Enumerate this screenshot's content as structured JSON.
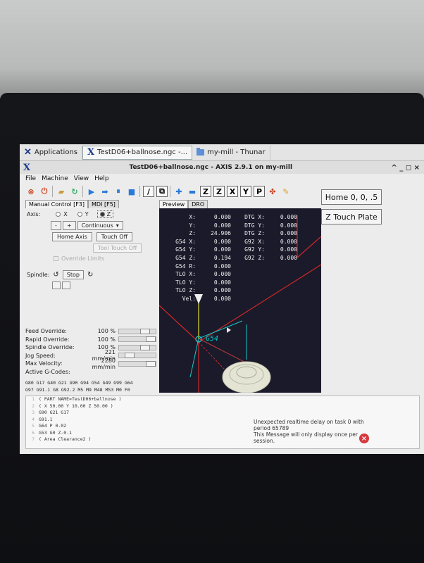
{
  "taskbar": {
    "apps_label": "Applications",
    "task1": "TestD06+ballnose.ngc -...",
    "task2": "my-mill - Thunar"
  },
  "window": {
    "title": "TestD06+ballnose.ngc - AXIS 2.9.1 on my-mill",
    "controls": "^  _  ◻  ×"
  },
  "menu": [
    "File",
    "Machine",
    "View",
    "Help"
  ],
  "side_buttons": [
    "Home 0, 0, .5",
    "Z Touch Plate"
  ],
  "tabs": {
    "manual": "Manual Control [F3]",
    "mdi": "MDI [F5]",
    "preview": "Preview",
    "dro": "DRO"
  },
  "manual": {
    "axis_label": "Axis:",
    "axes": [
      "X",
      "Y",
      "Z"
    ],
    "selected_axis": "Z",
    "minus": "-",
    "plus": "+",
    "jog_mode": "Continuous",
    "home_axis": "Home Axis",
    "touch_off": "Touch Off",
    "tool_touch_off": "Tool Touch Off",
    "override_limits": "Override Limits",
    "spindle_label": "Spindle:",
    "stop": "Stop"
  },
  "sliders": [
    {
      "label": "Feed Override:",
      "value": "100 %"
    },
    {
      "label": "Rapid Override:",
      "value": "100 %"
    },
    {
      "label": "Spindle Override:",
      "value": "100 %"
    },
    {
      "label": "Jog Speed:",
      "value": "221 mm/min"
    },
    {
      "label": "Max Velocity:",
      "value": "2280 mm/min"
    }
  ],
  "active_gcodes_label": "Active G-Codes:",
  "gcodes": [
    "G80 G17 G40 G21 G90 G94 G54 G49 G99 G64",
    "G97 G91.1 G8 G92.2 M5 M9 M48 M53 M0 F0"
  ],
  "dro": [
    {
      "l": "X:",
      "v": "0.000",
      "l2": "DTG X:",
      "v2": "0.000"
    },
    {
      "l": "Y:",
      "v": "0.000",
      "l2": "DTG Y:",
      "v2": "0.000"
    },
    {
      "l": "Z:",
      "v": "24.906",
      "l2": "DTG Z:",
      "v2": "0.000"
    },
    {
      "l": "G54 X:",
      "v": "0.000",
      "l2": "G92 X:",
      "v2": "0.000"
    },
    {
      "l": "G54 Y:",
      "v": "0.000",
      "l2": "G92 Y:",
      "v2": "0.000"
    },
    {
      "l": "G54 Z:",
      "v": "0.194",
      "l2": "G92 Z:",
      "v2": "0.000"
    },
    {
      "l": "G54 R:",
      "v": "0.000",
      "l2": "",
      "v2": ""
    },
    {
      "l": "TLO X:",
      "v": "0.000",
      "l2": "",
      "v2": ""
    },
    {
      "l": "TLO Y:",
      "v": "0.000",
      "l2": "",
      "v2": ""
    },
    {
      "l": "TLO Z:",
      "v": "0.000",
      "l2": "",
      "v2": ""
    },
    {
      "l": "Vel:",
      "v": "0.000",
      "l2": "",
      "v2": ""
    }
  ],
  "preview_label": "G54",
  "code_lines": [
    {
      "n": "1",
      "t": "( PART NAME=TestD06+ballnose )"
    },
    {
      "n": "2",
      "t": "( X 50.00 Y 10.00 Z 50.00 )"
    },
    {
      "n": "3",
      "t": "G90 G21 G17"
    },
    {
      "n": "4",
      "t": "G91.1"
    },
    {
      "n": "5",
      "t": "G64 P 0.02"
    },
    {
      "n": "6",
      "t": "G53 G0 Z-0.1"
    },
    {
      "n": "7",
      "t": "( Area Clearance2 )"
    }
  ],
  "message": "Unexpected realtime delay on task 0 with period 65789\nThis Message will only display once per session."
}
